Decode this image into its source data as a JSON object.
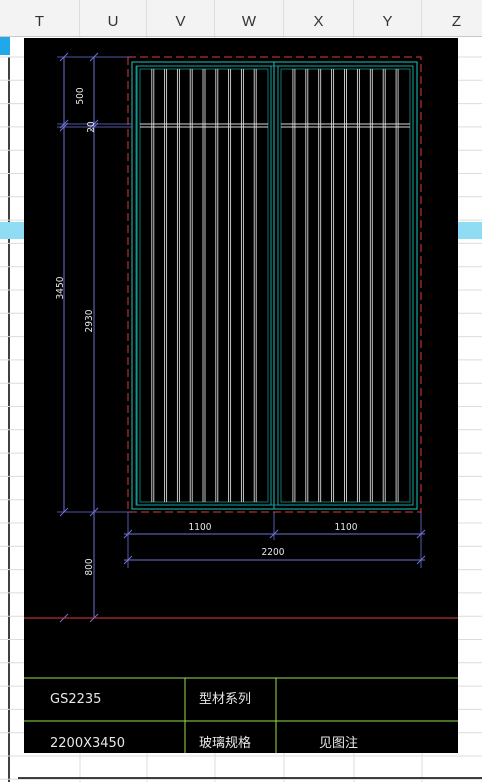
{
  "spreadsheet": {
    "columns": [
      "T",
      "U",
      "V",
      "W",
      "X",
      "Y",
      "Z"
    ],
    "selected_row_highlight": "#8fdcf5"
  },
  "drawing": {
    "dimensions": {
      "top_panel_height": "500",
      "transom_gap": "20",
      "total_height": "3450",
      "lower_panel_height": "2930",
      "sill_height": "800",
      "left_leaf_width": "1100",
      "right_leaf_width": "1100",
      "total_width": "2200"
    },
    "title_block": {
      "model_code": "GS2235",
      "profile_label": "型材系列",
      "size": "2200X3450",
      "glass_label": "玻璃规格",
      "glass_value": "见图注"
    },
    "colors": {
      "background": "#000000",
      "frame": "#16a5a0",
      "bars": "#d8d8d8",
      "dimension": "#6e72d6",
      "red_line": "#e23a3a",
      "title_lines": "#9adb4a"
    }
  }
}
